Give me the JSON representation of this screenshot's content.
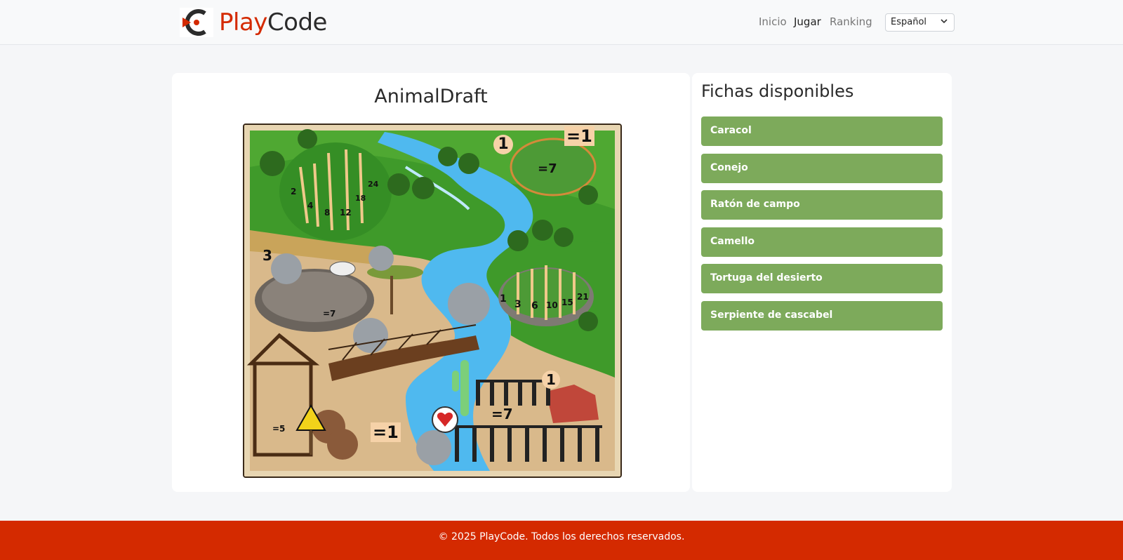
{
  "header": {
    "brand_part1": "Play",
    "brand_part2": "Code",
    "nav": [
      "Inicio",
      "Jugar",
      "Ranking"
    ],
    "active_nav": "Jugar",
    "language": "Español"
  },
  "game": {
    "title": "AnimalDraft",
    "board_labels": {
      "top_left_numbers": [
        "2",
        "4",
        "8",
        "12",
        "18",
        "24"
      ],
      "top_right_rule": "=1",
      "top_right_count": "1",
      "crown_rule": "=7",
      "left_count": "3",
      "left_rule": "=7",
      "right_numbers": [
        "1",
        "3",
        "6",
        "10",
        "15",
        "21"
      ],
      "bottom_right_count": "1",
      "bottom_left_rule": "=5",
      "bottom_mid_rule": "=1",
      "bottom_right_rule": "=7"
    }
  },
  "sidebar": {
    "title": "Fichas disponibles",
    "pieces": [
      "Caracol",
      "Conejo",
      "Ratón de campo",
      "Camello",
      "Tortuga del desierto",
      "Serpiente de cascabel"
    ]
  },
  "footer": {
    "text": "© 2025 PlayCode. Todos los derechos reservados."
  },
  "colors": {
    "brand_red": "#d42a00",
    "piece_green": "#7daa5b",
    "grass": "#3f9a2a",
    "river": "#4fb9ef",
    "sand": "#d8b88a"
  }
}
